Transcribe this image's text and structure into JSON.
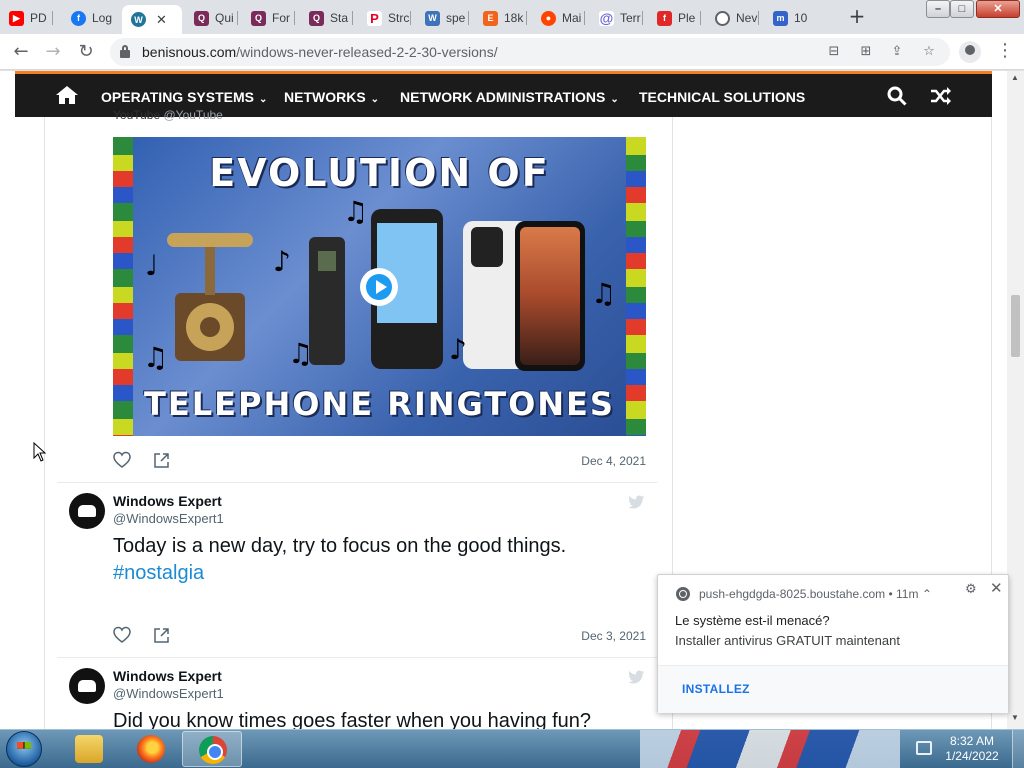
{
  "browser": {
    "tabs": [
      {
        "label": "PD",
        "icon": "youtube-icon",
        "color": "#ff0000"
      },
      {
        "label": "Log",
        "icon": "facebook-icon",
        "color": "#1877f2"
      },
      {
        "label": "",
        "icon": "wordpress-icon",
        "color": "#21759b",
        "active": true
      },
      {
        "label": "Qui",
        "icon": "quora-like-icon",
        "color": "#7a2b5a"
      },
      {
        "label": "For",
        "icon": "quora-like-icon",
        "color": "#7a2b5a"
      },
      {
        "label": "Sta",
        "icon": "quora-like-icon",
        "color": "#7a2b5a"
      },
      {
        "label": "Strc",
        "icon": "pinterest-like-icon",
        "color": "#e60023"
      },
      {
        "label": "spe",
        "icon": "w-icon",
        "color": "#3d73b8"
      },
      {
        "label": "18k",
        "icon": "etsy-icon",
        "color": "#f1641e"
      },
      {
        "label": "Mai",
        "icon": "reddit-icon",
        "color": "#ff4500"
      },
      {
        "label": "Terr",
        "icon": "at-icon",
        "color": "#6b63d8"
      },
      {
        "label": "Ple",
        "icon": "flipboard-icon",
        "color": "#e12828"
      },
      {
        "label": "Nev",
        "icon": "chrome-icon",
        "color": "#5f6368"
      },
      {
        "label": "10",
        "icon": "m-icon",
        "color": "#3563c9"
      }
    ],
    "new_tab": "+",
    "window_controls": {
      "minimize": "–",
      "maximize": "□",
      "close": "✕"
    },
    "url": {
      "host": "benisnous.com",
      "path": "/windows-never-released-2-2-30-versions/"
    }
  },
  "site_nav": {
    "items": [
      "OPERATING SYSTEMS",
      "NETWORKS",
      "NETWORK ADMINISTRATIONS",
      "TECHNICAL SOLUTIONS"
    ],
    "has_dropdown": [
      true,
      true,
      true,
      false
    ],
    "accent_color": "#f47e20"
  },
  "feed": {
    "embed_source": "YouTube",
    "embed_handle": "@YouTube",
    "video": {
      "title_top": "EVOLUTION OF",
      "title_bottom": "TELEPHONE RINGTONES"
    },
    "first_date": "Dec 4, 2021",
    "tweets": [
      {
        "name": "Windows Expert",
        "handle": "@WindowsExpert1",
        "text": "Today is a new day, try to focus on the good things.",
        "hashtag": "#nostalgia",
        "date": "Dec 3, 2021"
      },
      {
        "name": "Windows Expert",
        "handle": "@WindowsExpert1",
        "text": "Did you know times goes faster when you having fun?",
        "hashtag": "",
        "date": ""
      }
    ]
  },
  "notification": {
    "origin": "push-ehgdgda-8025.boustahe.com",
    "age": "• 11m",
    "title": "Le système est-il menacé?",
    "body": "Installer antivirus GRATUIT maintenant",
    "button": "INSTALLEZ"
  },
  "taskbar": {
    "time": "8:32 AM",
    "date": "1/24/2022"
  }
}
